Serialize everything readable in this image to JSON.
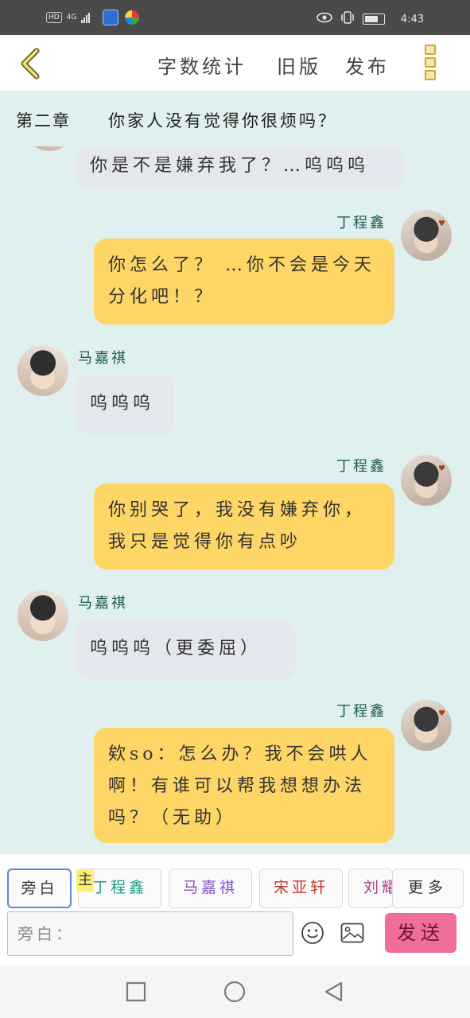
{
  "status_bar": {
    "network_badge": "HD",
    "network_type": "4G",
    "time": "4:43"
  },
  "header": {
    "word_count_label": "字数统计",
    "old_version_label": "旧版",
    "publish_label": "发布"
  },
  "chapter": {
    "label": "第二章",
    "title": "你家人没有觉得你很烦吗？"
  },
  "messages": [
    {
      "speaker": "",
      "side": "left",
      "text": "你是不是嫌弃我了？…呜呜呜"
    },
    {
      "speaker": "丁程鑫",
      "side": "right",
      "text": "你怎么了？ …你不会是今天分化吧！？"
    },
    {
      "speaker": "马嘉祺",
      "side": "left",
      "text": "呜呜呜"
    },
    {
      "speaker": "丁程鑫",
      "side": "right",
      "text": "你别哭了，我没有嫌弃你，我只是觉得你有点吵"
    },
    {
      "speaker": "马嘉祺",
      "side": "left",
      "text": "呜呜呜（更委屈）"
    },
    {
      "speaker": "丁程鑫",
      "side": "right",
      "text": "欸so：怎么办？我不会哄人啊！有谁可以帮我想想办法吗？（无助）"
    }
  ],
  "roles": {
    "narrator": "旁白",
    "main_tag": "主",
    "items": [
      "丁程鑫",
      "马嘉祺",
      "宋亚轩",
      "刘耀文"
    ],
    "more": "更多"
  },
  "composer": {
    "placeholder": "旁白：",
    "send_label": "发送"
  },
  "colors": {
    "background": "#dff0ee",
    "right_bubble": "#fdd666",
    "left_bubble": "#e4e7ee",
    "send_button": "#f06d9c",
    "name_color": "#1e5b4a"
  }
}
